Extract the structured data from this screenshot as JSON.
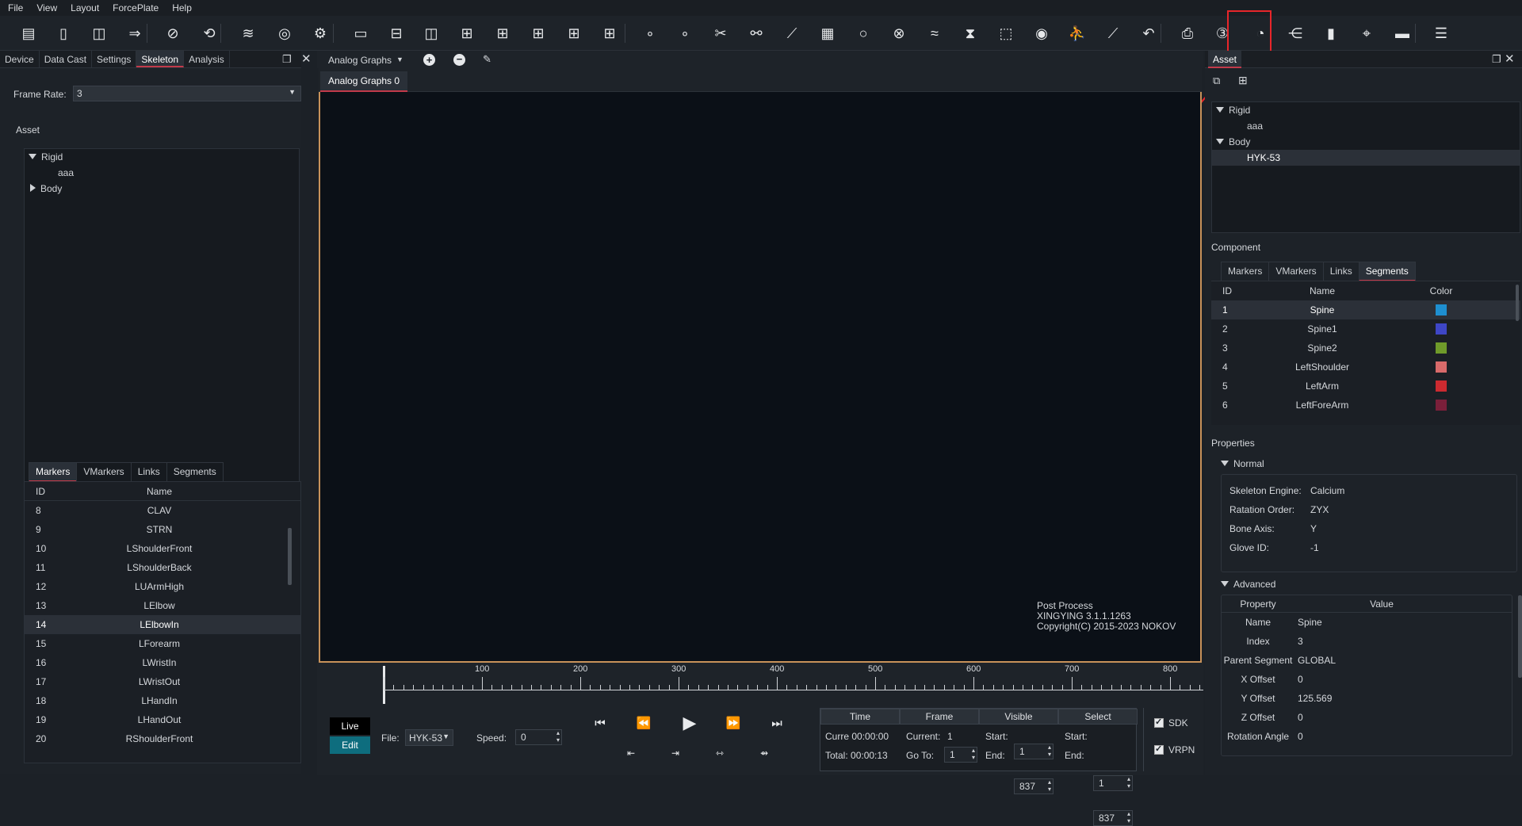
{
  "menu": [
    "File",
    "View",
    "Layout",
    "ForcePlate",
    "Help"
  ],
  "toolbar_icons": [
    "open-folder-icon",
    "new-file-icon",
    "save-icon",
    "save-as-icon",
    "visibility-off-icon",
    "sync-icon",
    "layers-icon",
    "wireless-camera-icon",
    "settings-gear-icon",
    "view-single-icon",
    "view-split-horizontal-icon",
    "view-split-vertical-icon",
    "view-three-top-icon",
    "view-three-bottom-icon",
    "view-three-left-icon",
    "view-three-right-icon",
    "view-quad-icon",
    "link-markers-icon",
    "unlink-markers-icon",
    "cut-icon",
    "connect-icon",
    "bone-icon",
    "calculator-icon",
    "circle-icon",
    "cross-circle-icon",
    "wave-filter-icon",
    "hourglass-icon",
    "select-box-icon",
    "rotate-target-icon",
    "run-figure-icon",
    "line-chart-icon",
    "undo-icon",
    "export-video-icon",
    "3d-view-icon",
    "speedometer-icon",
    "share-nodes-icon",
    "bar-chart-icon",
    "location-pin-icon",
    "folder-icon",
    "stack-list-icon"
  ],
  "left": {
    "tabs": [
      "Device",
      "Data Cast",
      "Settings",
      "Skeleton",
      "Analysis"
    ],
    "active_tab": "Skeleton",
    "frame_rate_label": "Frame Rate:",
    "frame_rate_value": "3",
    "asset_label": "Asset",
    "tree": {
      "rigid": "Rigid",
      "rigid_child": "aaa",
      "body": "Body"
    },
    "subtabs": [
      "Markers",
      "VMarkers",
      "Links",
      "Segments"
    ],
    "col_id": "ID",
    "col_name": "Name",
    "markers": [
      {
        "id": "8",
        "name": "CLAV"
      },
      {
        "id": "9",
        "name": "STRN"
      },
      {
        "id": "10",
        "name": "LShoulderFront"
      },
      {
        "id": "11",
        "name": "LShoulderBack"
      },
      {
        "id": "12",
        "name": "LUArmHigh"
      },
      {
        "id": "13",
        "name": "LElbow"
      },
      {
        "id": "14",
        "name": "LElbowIn"
      },
      {
        "id": "15",
        "name": "LForearm"
      },
      {
        "id": "16",
        "name": "LWristIn"
      },
      {
        "id": "17",
        "name": "LWristOut"
      },
      {
        "id": "18",
        "name": "LHandIn"
      },
      {
        "id": "19",
        "name": "LHandOut"
      },
      {
        "id": "20",
        "name": "RShoulderFront"
      }
    ]
  },
  "center": {
    "dropdown_label": "Analog Graphs",
    "graph_tab": "Analog Graphs 0",
    "info": [
      "Post Process",
      "XINGYING 3.1.1.1263",
      "Copyright(C) 2015-2023 NOKOV"
    ],
    "ruler_labels": [
      "100",
      "200",
      "300",
      "400",
      "500",
      "600",
      "700",
      "800"
    ]
  },
  "bottom": {
    "live": "Live",
    "edit": "Edit",
    "file_label": "File:",
    "file_value": "HYK-53",
    "speed_label": "Speed:",
    "speed_value": "0",
    "time_hdr": "Time",
    "frame_hdr": "Frame",
    "visible_hdr": "Visible",
    "select_hdr": "Select",
    "time_current": "Curre 00:00:00",
    "time_total": "Total: 00:00:13",
    "frame_current_label": "Current:",
    "frame_current_value": "1",
    "frame_goto_label": "Go To:",
    "frame_goto_value": "1",
    "start_label": "Start:",
    "end_label": "End:",
    "visible_start": "1",
    "visible_end": "837",
    "select_start": "1",
    "select_end": "837",
    "sdk": "SDK",
    "vrpn": "VRPN"
  },
  "right": {
    "tab": "Asset",
    "tree": {
      "rigid": "Rigid",
      "rigid_child": "aaa",
      "body": "Body",
      "body_child": "HYK-53"
    },
    "component_label": "Component",
    "subtabs": [
      "Markers",
      "VMarkers",
      "Links",
      "Segments"
    ],
    "col_id": "ID",
    "col_name": "Name",
    "col_color": "Color",
    "segments": [
      {
        "id": "1",
        "name": "Spine",
        "color": "#1e8fd0"
      },
      {
        "id": "2",
        "name": "Spine1",
        "color": "#3e46c6"
      },
      {
        "id": "3",
        "name": "Spine2",
        "color": "#6f9a2a"
      },
      {
        "id": "4",
        "name": "LeftShoulder",
        "color": "#d86a6a"
      },
      {
        "id": "5",
        "name": "LeftArm",
        "color": "#cc2a30"
      },
      {
        "id": "6",
        "name": "LeftForeArm",
        "color": "#7a1f3a"
      }
    ],
    "properties_label": "Properties",
    "normal_label": "Normal",
    "normal": [
      {
        "k": "Skeleton Engine:",
        "v": "Calcium"
      },
      {
        "k": "Ratation Order:",
        "v": "ZYX"
      },
      {
        "k": "Bone Axis:",
        "v": "Y"
      },
      {
        "k": "Glove ID:",
        "v": "-1"
      }
    ],
    "advanced_label": "Advanced",
    "adv_col_property": "Property",
    "adv_col_value": "Value",
    "advanced": [
      {
        "k": "Name",
        "v": "Spine"
      },
      {
        "k": "Index",
        "v": "3"
      },
      {
        "k": "Parent Segment",
        "v": "GLOBAL"
      },
      {
        "k": "X Offset",
        "v": "0"
      },
      {
        "k": "Y Offset",
        "v": "125.569"
      },
      {
        "k": "Z Offset",
        "v": "0"
      },
      {
        "k": "Rotation Angle",
        "v": "0"
      }
    ]
  },
  "colors": {
    "accent": "#c23a4a",
    "highlight": "#e8262a",
    "viewport": "#0b1017",
    "viewport_border": "#c8925a"
  }
}
